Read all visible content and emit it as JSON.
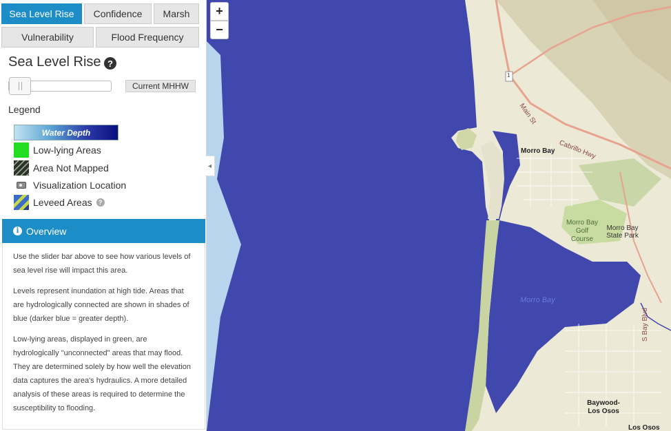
{
  "tabs": {
    "sea_level_rise": "Sea Level Rise",
    "confidence": "Confidence",
    "marsh": "Marsh",
    "vulnerability": "Vulnerability",
    "flood_frequency": "Flood Frequency"
  },
  "panel": {
    "title": "Sea Level Rise",
    "help_glyph": "?",
    "slider": {
      "value_label": "Current MHHW",
      "position": 0
    }
  },
  "legend": {
    "title": "Legend",
    "water_depth": "Water Depth",
    "items": [
      {
        "label": "Low-lying Areas",
        "icon": "low-lying-swatch"
      },
      {
        "label": "Area Not Mapped",
        "icon": "area-not-mapped-swatch"
      },
      {
        "label": "Visualization Location",
        "icon": "camera-icon"
      },
      {
        "label": "Leveed Areas",
        "icon": "leveed-swatch"
      }
    ]
  },
  "overview": {
    "title": "Overview",
    "paragraphs": [
      "Use the slider bar above to see how various levels of sea level rise will impact this area.",
      "Levels represent inundation at high tide. Areas that are hydrologically connected are shown in shades of blue (darker blue = greater depth).",
      "Low-lying areas, displayed in green, are hydrologically \"unconnected\" areas that may flood. They are determined solely by how well the elevation data captures the area's hydraulics. A more detailed analysis of these areas is required to determine the susceptibility to flooding."
    ]
  },
  "map": {
    "zoom_in": "+",
    "zoom_out": "−",
    "collapse_glyph": "◂",
    "highway_shield": "1",
    "labels": {
      "morro_bay": "Morro Bay",
      "main_st": "Main St",
      "cabrillo_hwy": "Cabrillo Hwy",
      "golf_course": "Morro Bay Golf Course",
      "state_park": "Morro Bay State Park",
      "bay": "Morro Bay",
      "s_bay_blvd": "S Bay Blvd",
      "baywood": "Baywood-Los Osos",
      "los_osos": "Los Osos"
    }
  },
  "colors": {
    "tab_active": "#1d8dc8",
    "ocean_flood": "#4048ad",
    "low_lying": "#22dd22"
  }
}
